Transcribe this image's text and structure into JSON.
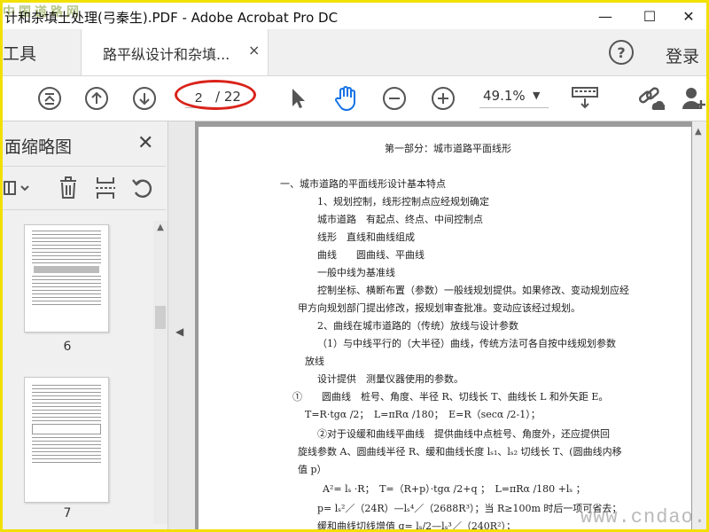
{
  "window": {
    "title": "计和杂填土处理(弓秦生).PDF - Adobe Acrobat Pro DC",
    "watermark_top_left": "中国道路网",
    "controls": {
      "minimize": "—",
      "maximize": "☐",
      "close": "✕"
    }
  },
  "tabs": {
    "tools_label": "工具",
    "document_label": "路平纵设计和杂填...",
    "close_glyph": "×",
    "help_glyph": "?",
    "login_label": "登录"
  },
  "toolbar": {
    "current_page": "2",
    "total_pages": "/ 22",
    "zoom": "49.1%",
    "icons": [
      "first-page-icon",
      "prev-page-icon",
      "next-page-icon",
      "select-arrow-icon",
      "hand-tool-icon",
      "zoom-out-icon",
      "zoom-in-icon",
      "keyboard-scroll-icon",
      "share-link-icon",
      "add-user-icon"
    ],
    "highlight_color": "#d9231a",
    "accent_color": "#1473e6"
  },
  "left_panel": {
    "title": "面缩略图",
    "close_glyph": "✕",
    "tools": [
      "options-menu-icon",
      "delete-page-icon",
      "extract-page-icon",
      "undo-icon"
    ],
    "thumbnails": [
      {
        "page_label": "6"
      },
      {
        "page_label": "7"
      }
    ]
  },
  "document": {
    "lines": [
      "第一部分：城市道路平面线形",
      "一、城市道路的平面线形设计基本特点",
      "1、规划控制，线形控制点应经规划确定",
      "城市道路　有起点、终点、中间控制点",
      "线形　直线和曲线组成",
      "曲线　　圆曲线、平曲线",
      "一般中线为基准线",
      "控制坐标、横断布置（参数）一般线规划提供。如果修改、变动规划应经",
      "甲方向规划部门提出修改，报规划审查批准。变动应该经过规划。",
      "2、曲线在城市道路的（传统）放线与设计参数",
      "（1）与中线平行的（大半径）曲线，传统方法可各自按中线规划参数",
      "放线",
      "设计提供　测量仪器使用的参数。",
      "①　　圆曲线　桩号、角度、半径 R、切线长 T、曲线长 L 和外矢距 E。",
      "T=R·tgα /2；　L=πRα /180；　E=R（secα /2-1）；",
      "②对于设缓和曲线平曲线　提供曲线中点桩号、角度外，还应提供回",
      "旋线参数 A、圆曲线半径 R、缓和曲线长度 lₛ₁、lₛ₂ 切线长 T、(圆曲线内移",
      "值 p）",
      "A²= lₛ ·R；　T=（R+p）·tgα /2+q ；　L=πRα /180 +lₛ ；",
      "p= lₛ²／（24R）—lₛ⁴／（2688R³）；当 R≥100m 时后一项可省去；",
      "缓和曲线切线增值 q= lₛ/2—lₛ³／（240R²）；"
    ]
  },
  "watermark": "www.cndao.com"
}
